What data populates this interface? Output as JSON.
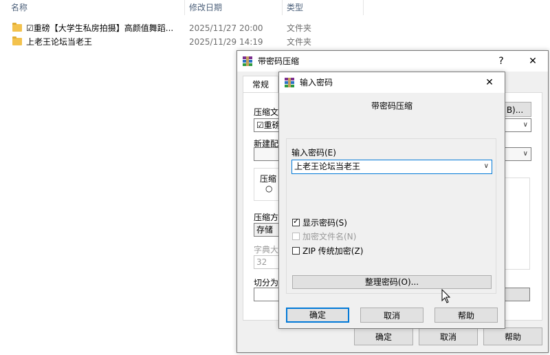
{
  "explorer": {
    "headers": {
      "name": "名称",
      "modified": "修改日期",
      "type": "类型"
    },
    "rows": [
      {
        "name": "☑重磅【大学生私房拍摄】高颜值舞蹈...",
        "date": "2025/11/27 20:00",
        "type": "文件夹"
      },
      {
        "name": "上老王论坛当老王",
        "date": "2025/11/29 14:19",
        "type": "文件夹"
      }
    ]
  },
  "back_dialog": {
    "title": "带密码压缩",
    "help": "?",
    "close": "✕",
    "tab": "常规",
    "archive_label": "压缩文",
    "archive_value": "☑重磅",
    "browse_label": "B)...",
    "new_label": "新建配",
    "method_group": "压缩",
    "method_radio": "○",
    "compress_label": "压缩方",
    "compress_value": "存储",
    "dict_label": "字典大",
    "dict_value": "32",
    "split_label": "切分为",
    "ok": "确定",
    "cancel": "取消",
    "help_btn": "帮助"
  },
  "dialog": {
    "title": "输入密码",
    "close": "✕",
    "heading": "带密码压缩",
    "password_label": "输入密码(E)",
    "password_value": "上老王论坛当老王",
    "show_password": "显示密码(S)",
    "encrypt_names": "加密文件名(N)",
    "zip_legacy": "ZIP 传统加密(Z)",
    "organize": "整理密码(O)...",
    "ok": "确定",
    "cancel": "取消",
    "help": "帮助"
  }
}
